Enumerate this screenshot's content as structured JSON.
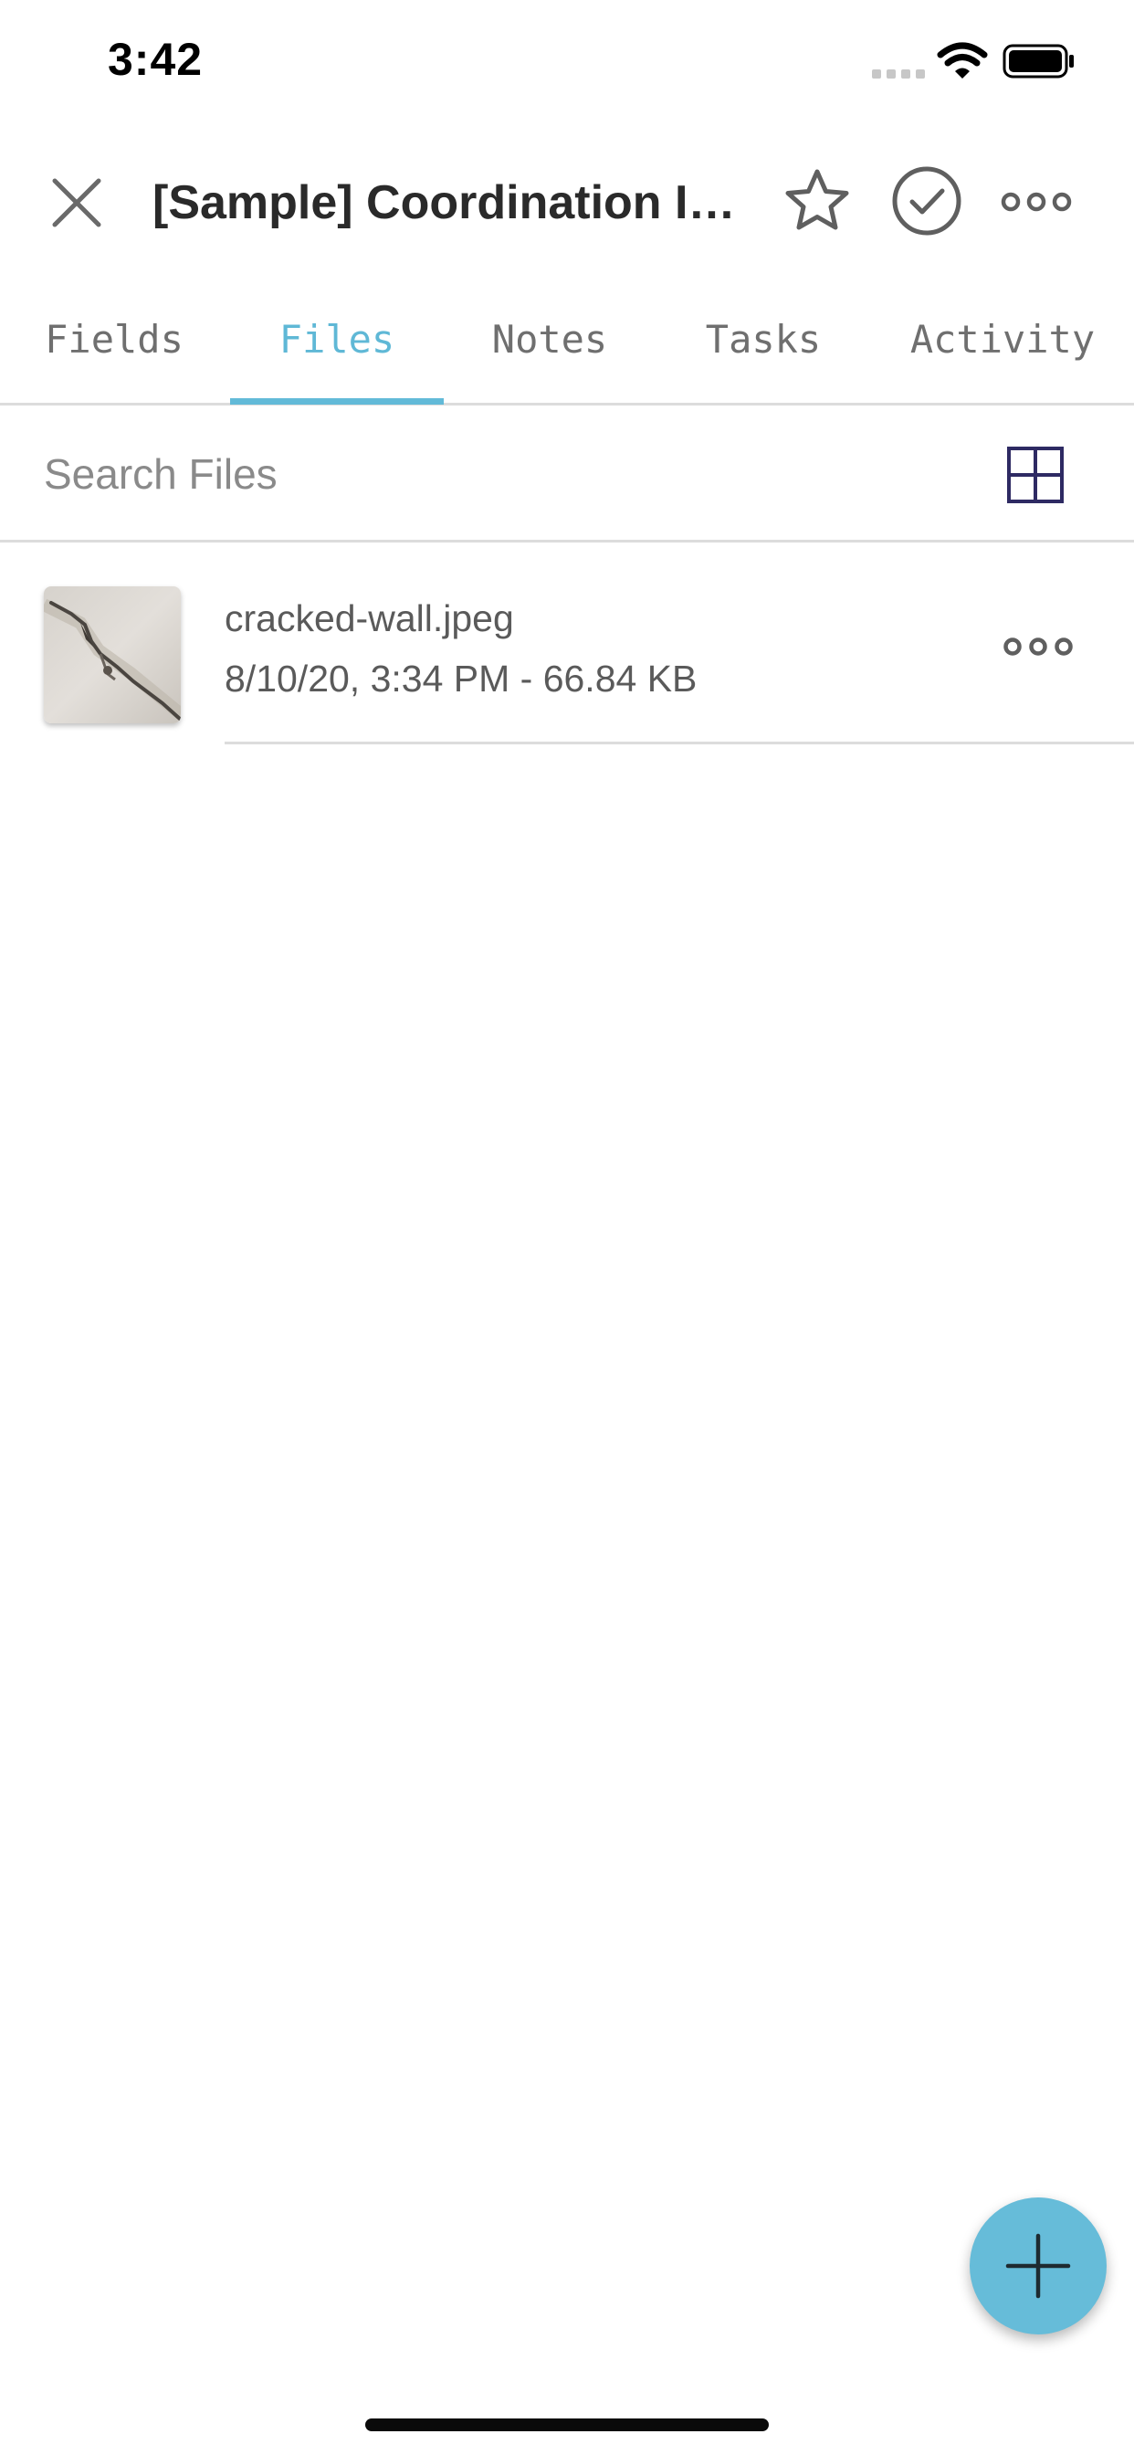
{
  "status_bar": {
    "time": "3:42",
    "signal_icon": "cellular-signal-icon",
    "wifi_icon": "wifi-icon",
    "battery_icon": "battery-icon"
  },
  "header": {
    "title": "[Sample] Coordination Iss...",
    "close_icon": "close-icon",
    "star_icon": "star-icon",
    "check_icon": "check-circle-icon",
    "more_icon": "more-horizontal-icon"
  },
  "tabs": [
    {
      "label": "Fields",
      "active": false
    },
    {
      "label": "Files",
      "active": true
    },
    {
      "label": "Notes",
      "active": false
    },
    {
      "label": "Tasks",
      "active": false
    },
    {
      "label": "Activity",
      "active": false
    }
  ],
  "search": {
    "placeholder": "Search Files",
    "value": "",
    "view_toggle_icon": "grid-view-icon"
  },
  "files": [
    {
      "name": "cracked-wall.jpeg",
      "meta": "8/10/20, 3:34 PM - 66.84 KB",
      "thumbnail_icon": "image-thumbnail",
      "more_icon": "more-horizontal-icon"
    }
  ],
  "fab": {
    "icon": "plus-icon"
  },
  "colors": {
    "accent": "#62bad8",
    "fab": "#66bcd9",
    "grid_icon": "#2e2a63",
    "divider": "#dcdcdc",
    "tab_text": "#6f6f6f"
  }
}
